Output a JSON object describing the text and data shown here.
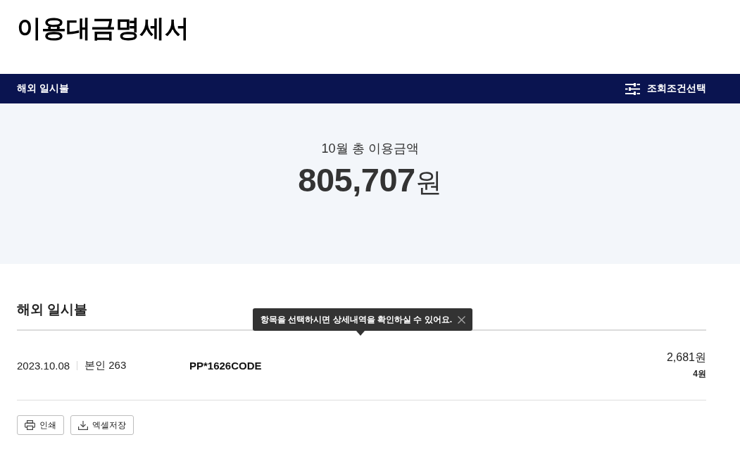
{
  "page_title": "이용대금명세서",
  "category_bar": {
    "label": "해외 일시불",
    "filter_button": "조회조건선택"
  },
  "summary": {
    "label": "10월 총 이용금액",
    "amount": "805,707",
    "currency": "원"
  },
  "section": {
    "title": "해외 일시불",
    "tooltip": {
      "text": "항목을 선택하시면 상세내역을 확인하실 수 있어요."
    },
    "transactions": [
      {
        "date": "2023.10.08",
        "card": "본인 263",
        "merchant": "PP*1626CODE",
        "amount": "2,681원",
        "sub_amount": "4원"
      }
    ]
  },
  "actions": [
    {
      "kind": "print",
      "label": "인쇄"
    },
    {
      "kind": "download",
      "label": "엑셀저장"
    }
  ]
}
